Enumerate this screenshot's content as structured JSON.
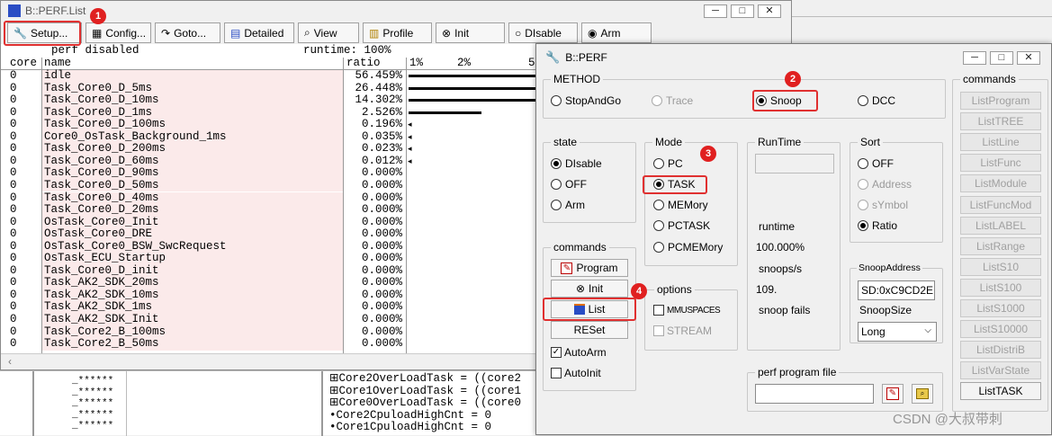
{
  "list_window": {
    "title": "B::PERF.List",
    "toolbar": [
      {
        "label": "Setup...",
        "icon": "wrench-icon"
      },
      {
        "label": "Config...",
        "icon": "grid-icon"
      },
      {
        "label": "Goto...",
        "icon": "goto-icon"
      },
      {
        "label": "Detailed",
        "icon": "list-icon"
      },
      {
        "label": "View",
        "icon": "magnifier-icon"
      },
      {
        "label": "Profile",
        "icon": "histogram-icon"
      },
      {
        "label": "Init",
        "icon": "circle-x-icon"
      },
      {
        "label": "DIsable",
        "icon": "circle-icon"
      },
      {
        "label": "Arm",
        "icon": "circle-dot-icon"
      }
    ],
    "status": "perf disabled",
    "runtime": "runtime: 100%",
    "headers": {
      "core": "core",
      "name": "name",
      "ratio": "ratio",
      "scale": [
        "1%",
        "2%",
        "5"
      ]
    },
    "rows": [
      {
        "core": "0",
        "name": "idle",
        "ratio": "56.459%",
        "bar": 1.0
      },
      {
        "core": "0",
        "name": "Task_Core0_D_5ms",
        "ratio": "26.448%",
        "bar": 1.0
      },
      {
        "core": "0",
        "name": "Task_Core0_D_10ms",
        "ratio": "14.302%",
        "bar": 1.0
      },
      {
        "core": "0",
        "name": "Task_Core0_D_1ms",
        "ratio": "2.526%",
        "bar": 0.55
      },
      {
        "core": "0",
        "name": "Task_Core0_D_100ms",
        "ratio": "0.196%",
        "bar": 0.02
      },
      {
        "core": "0",
        "name": "Core0_OsTask_Background_1ms",
        "ratio": "0.035%",
        "bar": 0.01
      },
      {
        "core": "0",
        "name": "Task_Core0_D_200ms",
        "ratio": "0.023%",
        "bar": 0.01
      },
      {
        "core": "0",
        "name": "Task_Core0_D_60ms",
        "ratio": "0.012%",
        "bar": 0.01
      },
      {
        "core": "0",
        "name": "Task_Core0_D_90ms",
        "ratio": "0.000%",
        "bar": 0
      },
      {
        "core": "0",
        "name": "Task_Core0_D_50ms",
        "ratio": "0.000%",
        "bar": 0
      },
      {
        "core": "0",
        "name": "Task_Core0_D_40ms",
        "ratio": "0.000%",
        "bar": 0
      },
      {
        "core": "0",
        "name": "Task_Core0_D_20ms",
        "ratio": "0.000%",
        "bar": 0
      },
      {
        "core": "0",
        "name": "OsTask_Core0_Init",
        "ratio": "0.000%",
        "bar": 0
      },
      {
        "core": "0",
        "name": "OsTask_Core0_DRE",
        "ratio": "0.000%",
        "bar": 0
      },
      {
        "core": "0",
        "name": "OsTask_Core0_BSW_SwcRequest",
        "ratio": "0.000%",
        "bar": 0
      },
      {
        "core": "0",
        "name": "OsTask_ECU_Startup",
        "ratio": "0.000%",
        "bar": 0
      },
      {
        "core": "0",
        "name": "Task_Core0_D_init",
        "ratio": "0.000%",
        "bar": 0
      },
      {
        "core": "0",
        "name": "Task_AK2_SDK_20ms",
        "ratio": "0.000%",
        "bar": 0
      },
      {
        "core": "0",
        "name": "Task_AK2_SDK_10ms",
        "ratio": "0.000%",
        "bar": 0
      },
      {
        "core": "0",
        "name": "Task_AK2_SDK_1ms",
        "ratio": "0.000%",
        "bar": 0
      },
      {
        "core": "0",
        "name": "Task_AK2_SDK_Init",
        "ratio": "0.000%",
        "bar": 0
      },
      {
        "core": "0",
        "name": "Task_Core2_B_100ms",
        "ratio": "0.000%",
        "bar": 0
      },
      {
        "core": "0",
        "name": "Task_Core2_B_50ms",
        "ratio": "0.000%",
        "bar": 0
      }
    ]
  },
  "background": {
    "stars": [
      "_******",
      "_******",
      "_******",
      "_******",
      "_******"
    ],
    "watch_lines": [
      {
        "prefix": "⊞",
        "text": "Core2OverLoadTask = ((core2"
      },
      {
        "prefix": "⊞",
        "text": "Core1OverLoadTask = ((core1"
      },
      {
        "prefix": "⊞",
        "text": "Core0OverLoadTask = ((core0"
      },
      {
        "prefix": "•",
        "text": "Core2CpuloadHighCnt = 0"
      },
      {
        "prefix": "•",
        "text": "Core1CpuloadHighCnt = 0"
      }
    ]
  },
  "perf_window": {
    "title": "B::PERF",
    "method": {
      "title": "METHOD",
      "options": [
        {
          "label": "StopAndGo",
          "selected": false,
          "disabled": false
        },
        {
          "label": "Trace",
          "selected": false,
          "disabled": true
        },
        {
          "label": "Snoop",
          "selected": true,
          "disabled": false
        },
        {
          "label": "DCC",
          "selected": false,
          "disabled": false
        }
      ]
    },
    "state": {
      "title": "state",
      "options": [
        {
          "label": "DIsable",
          "selected": true
        },
        {
          "label": "OFF",
          "selected": false
        },
        {
          "label": "Arm",
          "selected": false
        }
      ]
    },
    "mode": {
      "title": "Mode",
      "options": [
        {
          "label": "PC",
          "selected": false
        },
        {
          "label": "TASK",
          "selected": true
        },
        {
          "label": "MEMory",
          "selected": false
        },
        {
          "label": "PCTASK",
          "selected": false
        },
        {
          "label": "PCMEMory",
          "selected": false
        }
      ]
    },
    "runtime": {
      "title": "RunTime",
      "runtime_label": "runtime",
      "runtime_value": "100.000%",
      "snoops_label": "snoops/s",
      "snoops_value": "109.",
      "fails_label": "snoop fails"
    },
    "sort": {
      "title": "Sort",
      "options": [
        {
          "label": "OFF",
          "selected": false,
          "disabled": false
        },
        {
          "label": "Address",
          "selected": false,
          "disabled": true
        },
        {
          "label": "sYmbol",
          "selected": false,
          "disabled": true
        },
        {
          "label": "Ratio",
          "selected": true,
          "disabled": false
        }
      ]
    },
    "snoop_address": {
      "title": "SnoopAddress",
      "value": "SD:0xC9CD2E"
    },
    "snoop_size": {
      "title": "SnoopSize",
      "value": "Long"
    },
    "left_commands": {
      "title": "commands",
      "buttons": [
        {
          "label": "Program",
          "icon": "program-icon"
        },
        {
          "label": "Init",
          "icon": "circle-x-icon"
        },
        {
          "label": "List",
          "icon": "list-icon"
        },
        {
          "label": "RESet",
          "icon": ""
        }
      ],
      "checks": [
        {
          "label": "AutoArm",
          "checked": true
        },
        {
          "label": "AutoInit",
          "checked": false
        }
      ]
    },
    "options": {
      "title": "options",
      "checks": [
        {
          "label": "MMUSPACES",
          "checked": false,
          "disabled": false
        },
        {
          "label": "STREAM",
          "checked": false,
          "disabled": true
        }
      ]
    },
    "program_file": {
      "title": "perf program file",
      "value": ""
    },
    "right_commands": {
      "title": "commands",
      "buttons": [
        "ListProgram",
        "ListTREE",
        "ListLine",
        "ListFunc",
        "ListModule",
        "ListFuncMod",
        "ListLABEL",
        "ListRange",
        "ListS10",
        "ListS100",
        "ListS1000",
        "ListS10000",
        "ListDistriB",
        "ListVarState",
        "ListTASK"
      ]
    }
  },
  "annotations": {
    "badges": [
      "1",
      "2",
      "3",
      "4"
    ]
  },
  "watermark": "CSDN @大叔带刺",
  "colors": {
    "row_highlight": "#fbeaea",
    "annotation_red": "#e03030",
    "title_icon": "#2a4dc4"
  }
}
